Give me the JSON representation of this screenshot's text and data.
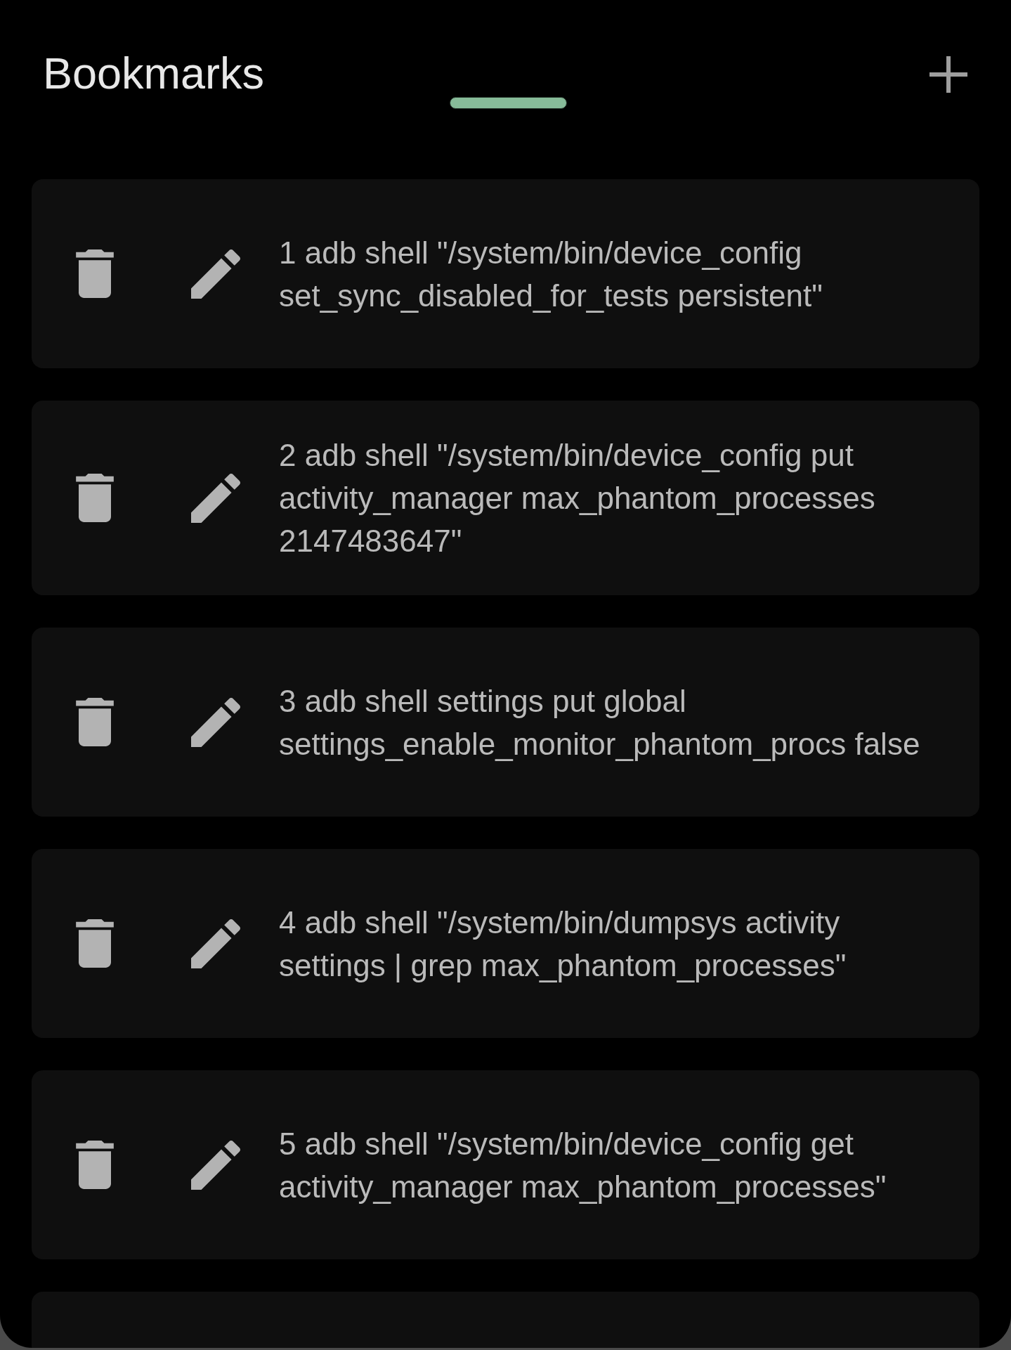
{
  "header": {
    "title": "Bookmarks"
  },
  "bookmarks": [
    {
      "command": "1 adb shell \"/system/bin/device_config set_sync_disabled_for_tests persistent\""
    },
    {
      "command": "2 adb shell \"/system/bin/device_config put activity_manager max_phantom_processes 2147483647\""
    },
    {
      "command": "3 adb shell settings put global settings_enable_monitor_phantom_procs false"
    },
    {
      "command": "4 adb shell \"/system/bin/dumpsys activity settings | grep max_phantom_processes\""
    },
    {
      "command": "5 adb shell \"/system/bin/device_config get activity_manager max_phantom_processes\""
    }
  ],
  "more_below": true
}
